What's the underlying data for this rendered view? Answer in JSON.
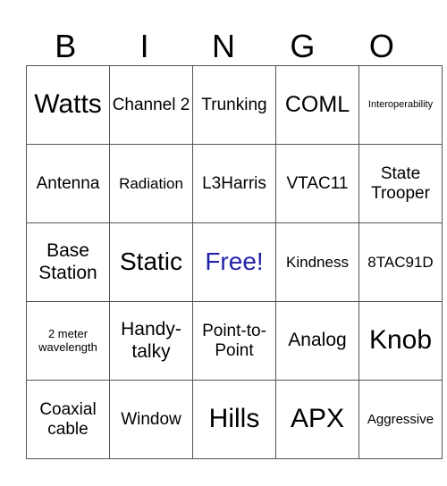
{
  "header": {
    "letters": [
      "B",
      "I",
      "N",
      "G",
      "O"
    ]
  },
  "free_color": "#2323a8",
  "rows": [
    [
      {
        "text": "Watts",
        "size": "s30"
      },
      {
        "text": "Channel 2",
        "size": "s19"
      },
      {
        "text": "Trunking",
        "size": "s19"
      },
      {
        "text": "COML",
        "size": "s25"
      },
      {
        "text": "Interoperability",
        "size": "s11"
      }
    ],
    [
      {
        "text": "Antenna",
        "size": "s19"
      },
      {
        "text": "Radiation",
        "size": "s17"
      },
      {
        "text": "L3Harris",
        "size": "s19"
      },
      {
        "text": "VTAC11",
        "size": "s19"
      },
      {
        "text": "State Trooper",
        "size": "s19"
      }
    ],
    [
      {
        "text": "Base Station",
        "size": "s22"
      },
      {
        "text": "Static",
        "size": "s28"
      },
      {
        "text": "Free!",
        "size": "s28",
        "free": true
      },
      {
        "text": "Kindness",
        "size": "s17"
      },
      {
        "text": "8TAC91D",
        "size": "s17"
      }
    ],
    [
      {
        "text": "2 meter wavelength",
        "size": "s13"
      },
      {
        "text": "Handy-talky",
        "size": "s22"
      },
      {
        "text": "Point-to-Point",
        "size": "s19"
      },
      {
        "text": "Analog",
        "size": "s22"
      },
      {
        "text": "Knob",
        "size": "s30"
      }
    ],
    [
      {
        "text": "Coaxial cable",
        "size": "s19"
      },
      {
        "text": "Window",
        "size": "s19"
      },
      {
        "text": "Hills",
        "size": "s30"
      },
      {
        "text": "APX",
        "size": "s30"
      },
      {
        "text": "Aggressive",
        "size": "s15"
      }
    ]
  ]
}
